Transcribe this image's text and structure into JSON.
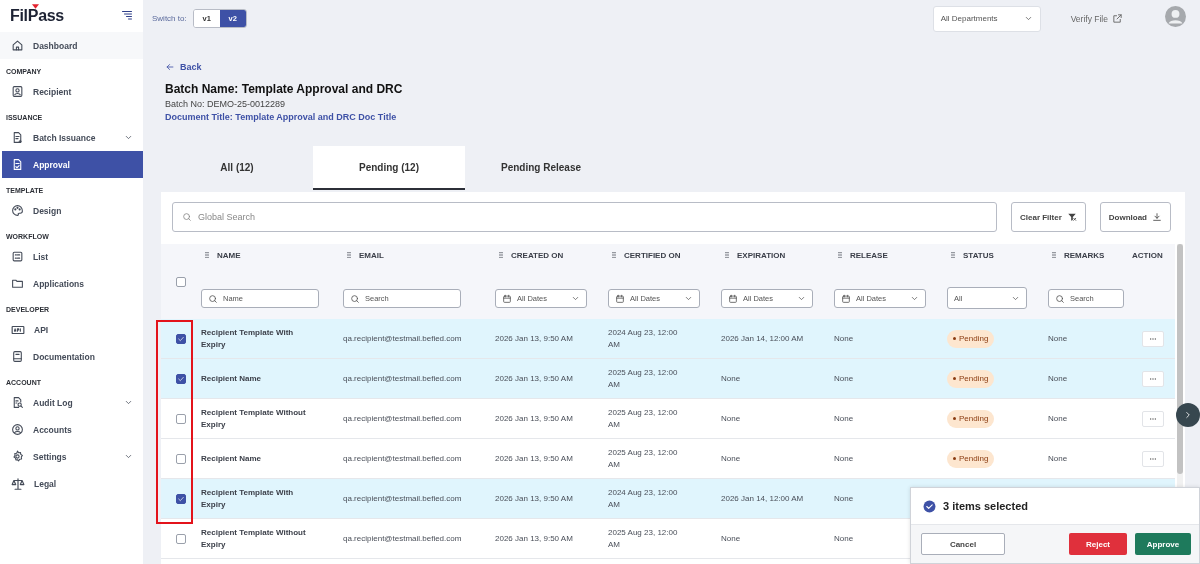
{
  "sidebar": {
    "logo": "FilPass",
    "groups": [
      {
        "items": [
          {
            "label": "Dashboard",
            "selected": false,
            "expandable": false
          }
        ]
      },
      {
        "heading": "COMPANY",
        "items": [
          {
            "label": "Recipient",
            "selected": false,
            "expandable": false
          }
        ]
      },
      {
        "heading": "ISSUANCE",
        "items": [
          {
            "label": "Batch Issuance",
            "selected": false,
            "expandable": true
          },
          {
            "label": "Approval",
            "selected": true,
            "expandable": false
          }
        ]
      },
      {
        "heading": "TEMPLATE",
        "items": [
          {
            "label": "Design",
            "selected": false,
            "expandable": false
          }
        ]
      },
      {
        "heading": "WORKFLOW",
        "items": [
          {
            "label": "List",
            "selected": false,
            "expandable": false
          },
          {
            "label": "Applications",
            "selected": false,
            "expandable": false
          }
        ]
      },
      {
        "heading": "DEVELOPER",
        "items": [
          {
            "label": "API",
            "selected": false,
            "expandable": false
          },
          {
            "label": "Documentation",
            "selected": false,
            "expandable": false
          }
        ]
      },
      {
        "heading": "ACCOUNT",
        "items": [
          {
            "label": "Audit Log",
            "selected": false,
            "expandable": true
          },
          {
            "label": "Accounts",
            "selected": false,
            "expandable": false
          },
          {
            "label": "Settings",
            "selected": false,
            "expandable": true
          },
          {
            "label": "Legal",
            "selected": false,
            "expandable": false
          }
        ]
      }
    ]
  },
  "topbar": {
    "switch_label": "Switch to:",
    "versions": [
      {
        "label": "v1",
        "selected": false
      },
      {
        "label": "v2",
        "selected": true
      }
    ],
    "department": "All Departments",
    "verify_link": "Verify File"
  },
  "header": {
    "back": "Back",
    "batch_name": "Batch Name: Template Approval and DRC",
    "batch_no": "Batch No: DEMO-25-0012289",
    "document_title": "Document Title: Template Approval and DRC Doc Title"
  },
  "tabs": [
    {
      "label": "All (12)",
      "selected": false
    },
    {
      "label": "Pending (12)",
      "selected": true
    },
    {
      "label": "Pending Release",
      "selected": false
    }
  ],
  "toolbar": {
    "search_placeholder": "Global Search",
    "buttons": [
      "Clear Filter",
      "Download"
    ]
  },
  "table": {
    "select_all": {
      "checked": false
    },
    "columns": [
      {
        "label": "NAME",
        "draggable": true,
        "filter": {
          "kind": "search",
          "placeholder": "Name"
        }
      },
      {
        "label": "EMAIL",
        "draggable": true,
        "filter": {
          "kind": "search",
          "placeholder": "Search"
        }
      },
      {
        "label": "CREATED ON",
        "draggable": true,
        "filter": {
          "kind": "date",
          "value": "All Dates"
        }
      },
      {
        "label": "CERTIFIED ON",
        "draggable": true,
        "filter": {
          "kind": "date",
          "value": "All Dates"
        }
      },
      {
        "label": "EXPIRATION",
        "draggable": true,
        "filter": {
          "kind": "date",
          "value": "All Dates"
        }
      },
      {
        "label": "RELEASE",
        "draggable": true,
        "filter": {
          "kind": "date",
          "value": "All Dates"
        }
      },
      {
        "label": "STATUS",
        "draggable": true,
        "filter": {
          "kind": "select",
          "value": "All"
        }
      },
      {
        "label": "REMARKS",
        "draggable": true,
        "filter": {
          "kind": "search",
          "placeholder": "Search"
        }
      },
      {
        "label": "ACTION",
        "draggable": false
      }
    ],
    "rows": [
      {
        "selected": true,
        "cells": [
          "Recipient Template With Expiry",
          "qa.recipient@testmail.befied.com",
          "2026 Jan 13, 9:50 AM",
          "2024 Aug 23, 12:00 AM",
          "2026 Jan 14, 12:00 AM",
          "None",
          "Pending",
          "None"
        ],
        "actions_menu": true
      },
      {
        "selected": true,
        "cells": [
          "Recipient Name",
          "qa.recipient@testmail.befied.com",
          "2026 Jan 13, 9:50 AM",
          "2025 Aug 23, 12:00 AM",
          "None",
          "None",
          "Pending",
          "None"
        ],
        "actions_menu": true
      },
      {
        "selected": false,
        "cells": [
          "Recipient Template Without Expiry",
          "qa.recipient@testmail.befied.com",
          "2026 Jan 13, 9:50 AM",
          "2025 Aug 23, 12:00 AM",
          "None",
          "None",
          "Pending",
          "None"
        ],
        "actions_menu": true
      },
      {
        "selected": false,
        "cells": [
          "Recipient Name",
          "qa.recipient@testmail.befied.com",
          "2026 Jan 13, 9:50 AM",
          "2025 Aug 23, 12:00 AM",
          "None",
          "None",
          "Pending",
          "None"
        ],
        "actions_menu": true
      },
      {
        "selected": true,
        "cells": [
          "Recipient Template With Expiry",
          "qa.recipient@testmail.befied.com",
          "2026 Jan 13, 9:50 AM",
          "2024 Aug 23, 12:00 AM",
          "2026 Jan 14, 12:00 AM",
          "None"
        ]
      },
      {
        "selected": false,
        "cells": [
          "Recipient Template Without Expiry",
          "qa.recipient@testmail.befied.com",
          "2026 Jan 13, 9:50 AM",
          "2025 Aug 23, 12:00 AM",
          "None",
          "None"
        ]
      }
    ]
  },
  "selection_bar": {
    "message": "3 items selected",
    "buttons": [
      {
        "label": "Cancel",
        "kind": "secondary"
      },
      {
        "label": "Reject",
        "kind": "danger"
      },
      {
        "label": "Approve",
        "kind": "primary"
      }
    ]
  }
}
